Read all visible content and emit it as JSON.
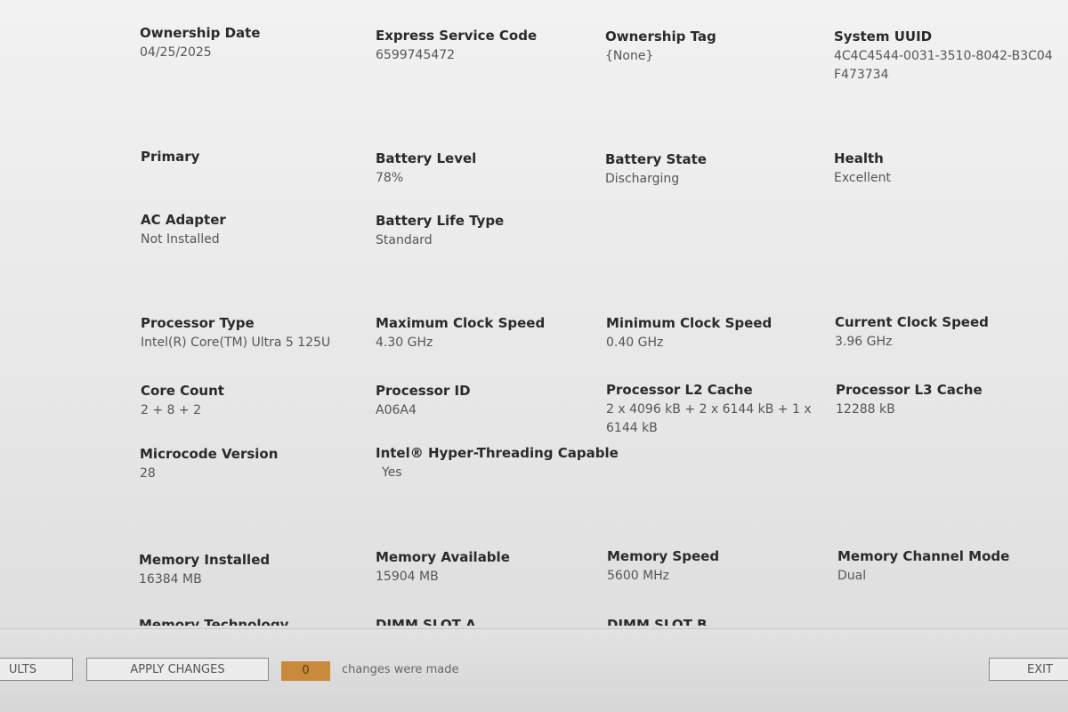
{
  "system": {
    "ownership_date": {
      "label": "Ownership Date",
      "value": "04/25/2025"
    },
    "express_service_code": {
      "label": "Express Service Code",
      "value": "6599745472"
    },
    "ownership_tag": {
      "label": "Ownership Tag",
      "value": "{None}"
    },
    "system_uuid": {
      "label": "System UUID",
      "value": "4C4C4544-0031-3510-8042-B3C04F473734"
    }
  },
  "battery": {
    "primary": {
      "label": "Primary"
    },
    "battery_level": {
      "label": "Battery Level",
      "value": "78%"
    },
    "battery_state": {
      "label": "Battery State",
      "value": "Discharging"
    },
    "health": {
      "label": "Health",
      "value": "Excellent"
    },
    "ac_adapter": {
      "label": "AC Adapter",
      "value": "Not Installed"
    },
    "battery_life_type": {
      "label": "Battery Life Type",
      "value": "Standard"
    }
  },
  "processor": {
    "processor_type": {
      "label": "Processor Type",
      "value": "Intel(R) Core(TM) Ultra 5 125U"
    },
    "max_clock": {
      "label": "Maximum Clock Speed",
      "value": "4.30 GHz"
    },
    "min_clock": {
      "label": "Minimum Clock Speed",
      "value": "0.40 GHz"
    },
    "current_clock": {
      "label": "Current Clock Speed",
      "value": "3.96 GHz"
    },
    "core_count": {
      "label": "Core Count",
      "value": "2 + 8 + 2"
    },
    "processor_id": {
      "label": "Processor ID",
      "value": "A06A4"
    },
    "l2_cache": {
      "label": "Processor L2 Cache",
      "value": "2 x 4096  kB + 2 x 6144  kB + 1 x 6144  kB"
    },
    "l3_cache": {
      "label": "Processor L3 Cache",
      "value": "12288 kB"
    },
    "microcode": {
      "label": "Microcode Version",
      "value": "28"
    },
    "hyperthreading": {
      "label": "Intel® Hyper-Threading Capable",
      "value": "Yes"
    }
  },
  "memory": {
    "installed": {
      "label": "Memory Installed",
      "value": "16384 MB"
    },
    "available": {
      "label": "Memory Available",
      "value": "15904 MB"
    },
    "speed": {
      "label": "Memory Speed",
      "value": "5600 MHz"
    },
    "channel_mode": {
      "label": "Memory Channel Mode",
      "value": "Dual"
    },
    "technology_label": "Memory Technology",
    "dimm_a_label": "DIMM SLOT A",
    "dimm_b_label": "DIMM SLOT B"
  },
  "footer": {
    "defaults_label": "ULTS",
    "apply_label": "APPLY CHANGES",
    "changes_count": "0",
    "changes_text": "changes were made",
    "exit_label": "EXIT"
  }
}
